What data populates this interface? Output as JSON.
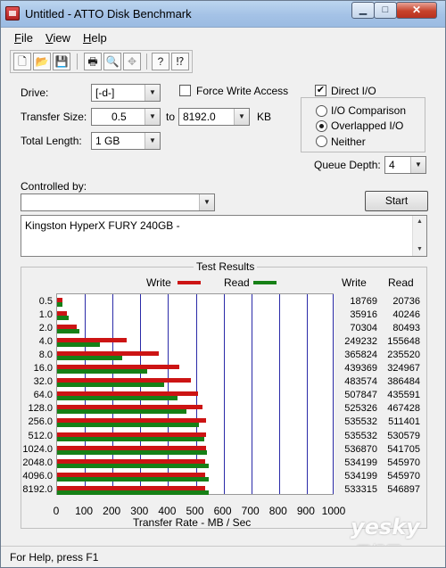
{
  "window": {
    "title": "Untitled - ATTO Disk Benchmark"
  },
  "menu": [
    {
      "key": "F",
      "rest": "ile"
    },
    {
      "key": "V",
      "rest": "iew"
    },
    {
      "key": "H",
      "rest": "elp"
    }
  ],
  "toolbar": {
    "buttons": [
      {
        "icon": "new-document-icon",
        "glyph": "🗋"
      },
      {
        "icon": "open-folder-icon",
        "glyph": "📂"
      },
      {
        "icon": "save-icon",
        "glyph": "💾"
      },
      {
        "icon": "print-icon",
        "glyph": "🖶"
      },
      {
        "icon": "print-preview-icon",
        "glyph": "🔍"
      },
      {
        "icon": "move-icon",
        "glyph": "✥"
      },
      {
        "icon": "help-icon",
        "glyph": "?"
      },
      {
        "icon": "context-help-icon",
        "glyph": "⁉"
      }
    ]
  },
  "form": {
    "drive_label": "Drive:",
    "drive_value": "[-d-]",
    "force_write_label": "Force Write Access",
    "force_write_checked": false,
    "direct_io_label": "Direct I/O",
    "direct_io_checked": true,
    "transfer_size_label": "Transfer Size:",
    "transfer_from": "0.5",
    "transfer_to_label": "to",
    "transfer_to": "8192.0",
    "transfer_unit": "KB",
    "total_length_label": "Total Length:",
    "total_length_value": "1 GB",
    "io_comparison_label": "I/O Comparison",
    "overlapped_io_label": "Overlapped I/O",
    "neither_label": "Neither",
    "selected_mode": "Overlapped I/O",
    "queue_depth_label": "Queue Depth:",
    "queue_depth_value": "4",
    "controlled_by_label": "Controlled by:",
    "controlled_by_value": "",
    "start_label": "Start",
    "description": "Kingston HyperX FURY 240GB -"
  },
  "results": {
    "title": "Test Results",
    "legend_write": "Write",
    "legend_read": "Read",
    "col_write": "Write",
    "col_read": "Read",
    "colors": {
      "write": "#cc1414",
      "read": "#168016",
      "grid": "#2a2aa8"
    }
  },
  "chart_data": {
    "type": "bar",
    "orientation": "horizontal",
    "title": "Test Results",
    "xlabel": "Transfer Rate - MB / Sec",
    "xlim": [
      0,
      1000
    ],
    "xticks": [
      "0",
      "100",
      "200",
      "300",
      "400",
      "500",
      "600",
      "700",
      "800",
      "900",
      "1000"
    ],
    "grid": true,
    "legend": "top-center",
    "categories": [
      "0.5",
      "1.0",
      "2.0",
      "4.0",
      "8.0",
      "16.0",
      "32.0",
      "64.0",
      "128.0",
      "256.0",
      "512.0",
      "1024.0",
      "2048.0",
      "4096.0",
      "8192.0"
    ],
    "series": [
      {
        "name": "Write",
        "values": [
          18769,
          35916,
          70304,
          249232,
          365824,
          439369,
          483574,
          507847,
          525326,
          535532,
          535532,
          536870,
          534199,
          534199,
          533315
        ]
      },
      {
        "name": "Read",
        "values": [
          20736,
          40246,
          80493,
          155648,
          235520,
          324967,
          386484,
          435591,
          467428,
          511401,
          530579,
          541705,
          545970,
          545970,
          546897
        ]
      }
    ]
  },
  "status": {
    "text": "For Help, press F1"
  },
  "watermark": {
    "main": "yesky",
    "sub": "天极网"
  }
}
